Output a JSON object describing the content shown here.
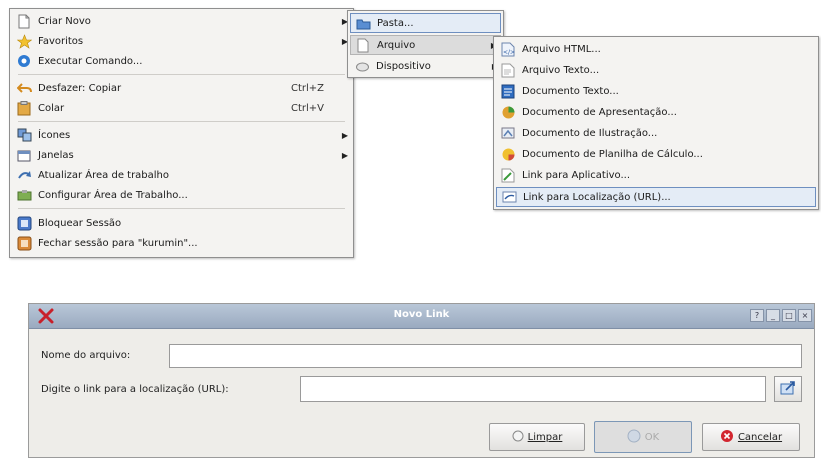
{
  "main_menu": {
    "items": [
      {
        "label": "Criar Novo",
        "icon": "document-icon",
        "submenu": true
      },
      {
        "label": "Favoritos",
        "icon": "star-icon",
        "submenu": true
      },
      {
        "label": "Executar Comando...",
        "icon": "run-icon"
      },
      {
        "label": "Desfazer: Copiar",
        "shortcut": "Ctrl+Z",
        "icon": "undo-icon"
      },
      {
        "label": "Colar",
        "shortcut": "Ctrl+V",
        "icon": "paste-icon"
      },
      {
        "label": "Ícones",
        "icon": "icons-icon",
        "submenu": true
      },
      {
        "label": "Janelas",
        "icon": "windows-icon",
        "submenu": true
      },
      {
        "label": "Atualizar Área de trabalho",
        "icon": "refresh-icon"
      },
      {
        "label": "Configurar Área de Trabalho...",
        "icon": "configure-icon"
      },
      {
        "label": "Bloquear Sessão",
        "icon": "lock-icon"
      },
      {
        "label": "Fechar sessão para \"kurumin\"...",
        "icon": "logout-icon"
      }
    ]
  },
  "create_submenu": {
    "items": [
      {
        "label": "Pasta...",
        "icon": "folder-icon"
      },
      {
        "label": "Arquivo",
        "submenu": true,
        "icon": "file-icon"
      },
      {
        "label": "Dispositivo",
        "submenu": true,
        "icon": "device-icon"
      }
    ]
  },
  "file_submenu": {
    "items": [
      {
        "label": "Arquivo HTML...",
        "icon": "html-icon"
      },
      {
        "label": "Arquivo Texto...",
        "icon": "text-file-icon"
      },
      {
        "label": "Documento Texto...",
        "icon": "writer-icon"
      },
      {
        "label": "Documento de Apresentação...",
        "icon": "impress-icon"
      },
      {
        "label": "Documento de Ilustração...",
        "icon": "draw-icon"
      },
      {
        "label": "Documento de Planilha de Cálculo...",
        "icon": "calc-icon"
      },
      {
        "label": "Link para Aplicativo...",
        "icon": "app-link-icon"
      },
      {
        "label": "Link para Localização (URL)...",
        "icon": "url-link-icon"
      }
    ]
  },
  "dialog": {
    "title": "Novo Link",
    "controls": {
      "help": "?",
      "minimize": "_",
      "maximize": "□",
      "close": "×"
    },
    "filename_label": "Nome do arquivo:",
    "filename_value": "",
    "url_label": "Digite o link para a localização (URL):",
    "url_value": "",
    "buttons": {
      "clear": "Limpar",
      "ok": "OK",
      "cancel": "Cancelar"
    }
  }
}
